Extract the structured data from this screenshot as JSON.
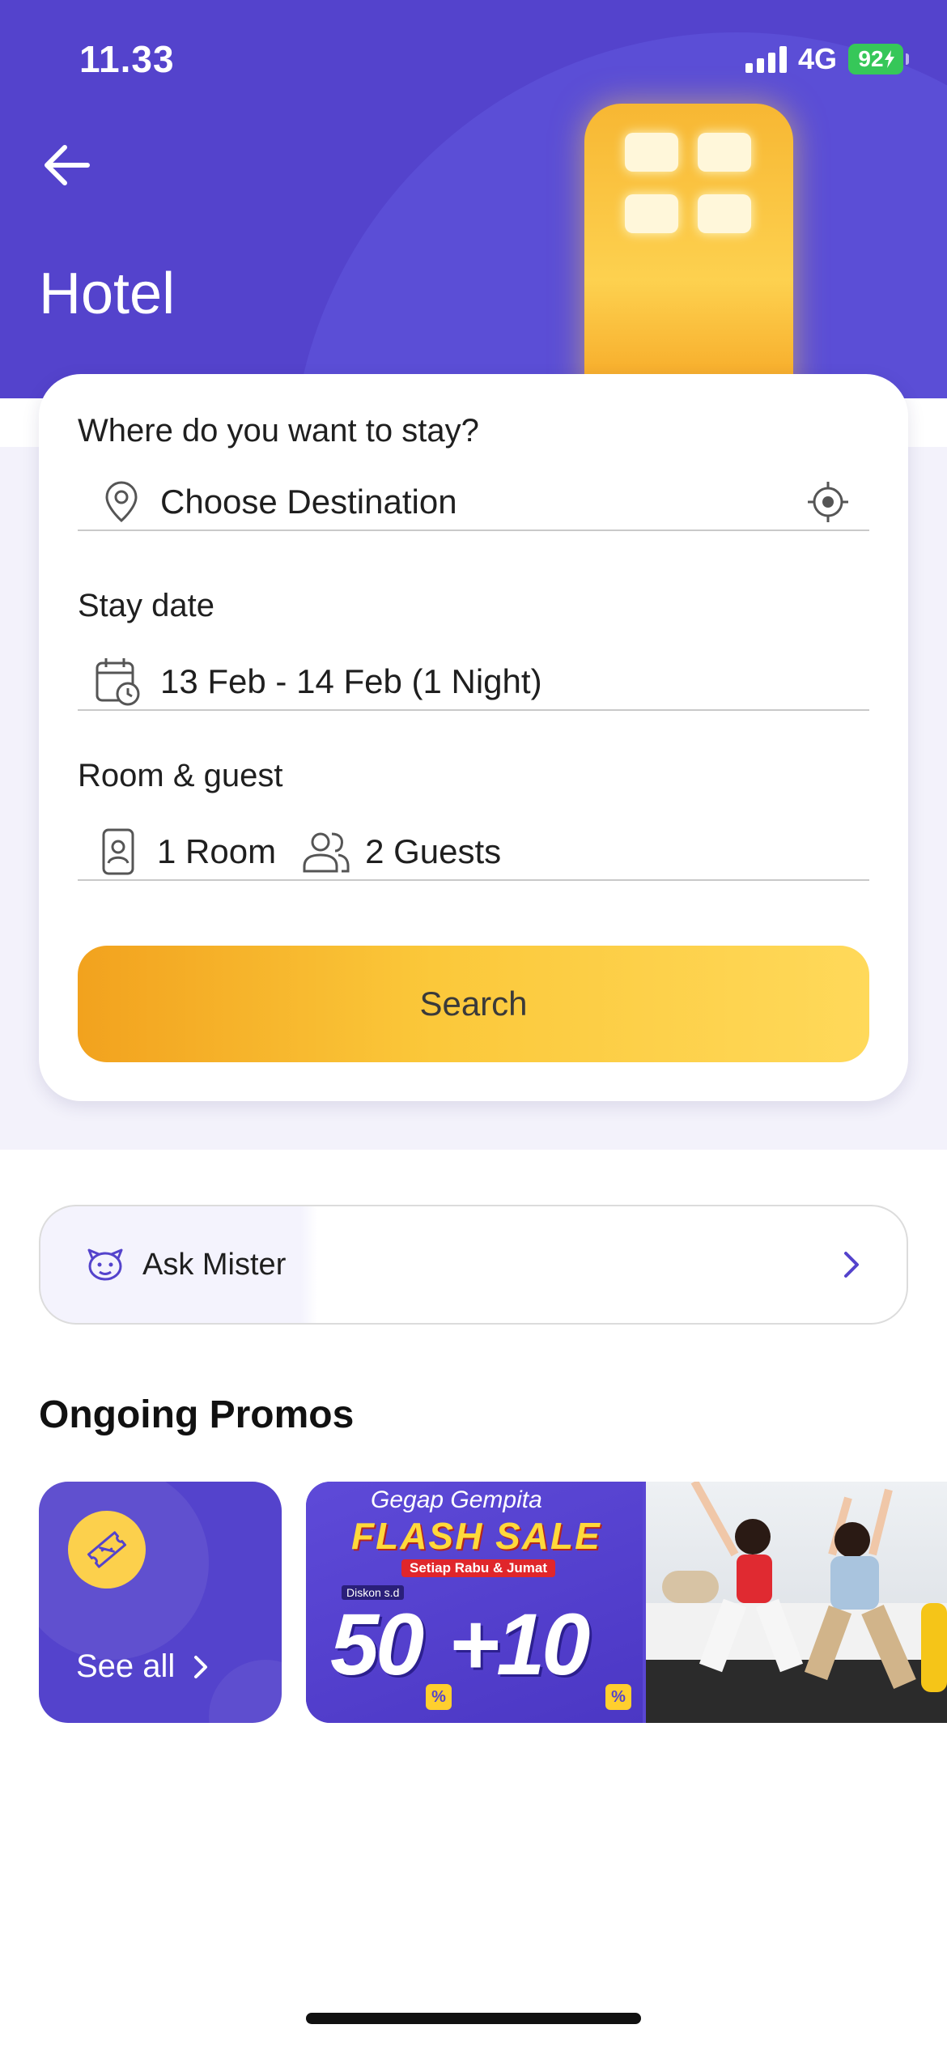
{
  "status_bar": {
    "time": "11.33",
    "network": "4G",
    "battery": "92"
  },
  "header": {
    "title": "Hotel"
  },
  "search_form": {
    "destination_label": "Where do you want to stay?",
    "destination_placeholder": "Choose Destination",
    "date_label": "Stay date",
    "date_value": "13 Feb - 14 Feb (1 Night)",
    "room_label": "Room & guest",
    "rooms_value": "1 Room",
    "guests_value": "2 Guests",
    "search_button": "Search"
  },
  "ask_mister": {
    "label": "Ask Mister"
  },
  "promos": {
    "title": "Ongoing Promos",
    "see_all": "See all",
    "banner": {
      "headline": "Gegap Gempita",
      "sale": "FLASH SALE",
      "schedule": "Setiap Rabu & Jumat",
      "discount_prefix": "Diskon s.d",
      "discount": "50",
      "extra": "+10",
      "percent": "%"
    }
  },
  "colors": {
    "primary": "#5443cc",
    "accent": "#fbc83a",
    "battery": "#36c759"
  }
}
